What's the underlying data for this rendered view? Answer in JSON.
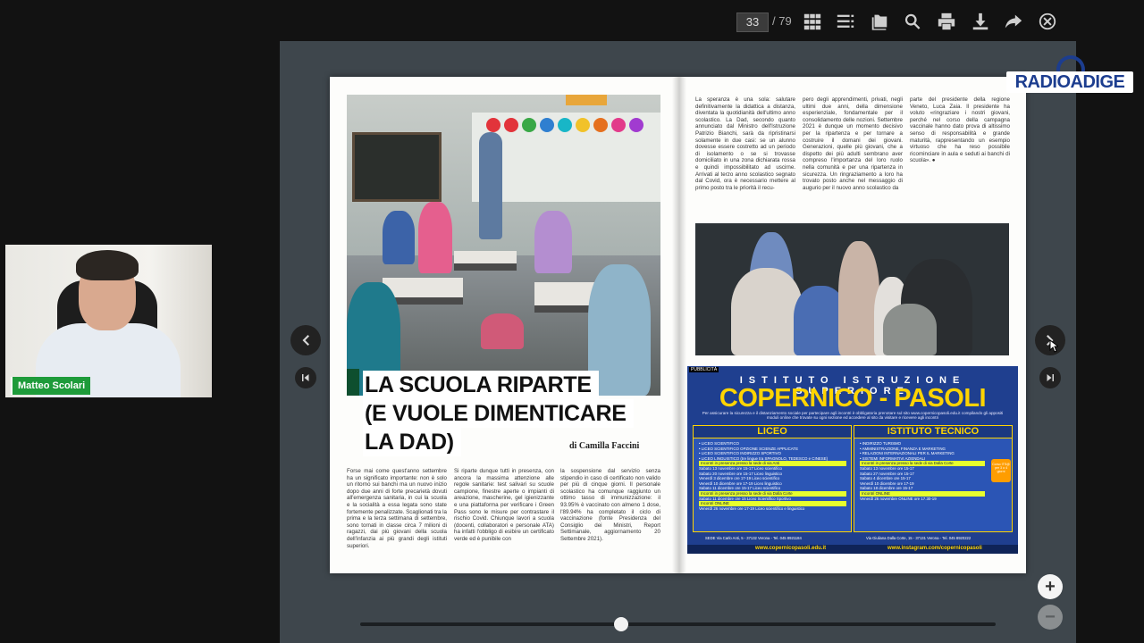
{
  "toolbar": {
    "current_page": "33",
    "total_pages": "/ 79",
    "icons": [
      "grid-icon",
      "list-icon",
      "folder-icon",
      "search-icon",
      "print-icon",
      "download-icon",
      "share-icon",
      "close-icon"
    ]
  },
  "article": {
    "headline_line1": "LA SCUOLA RIPARTE",
    "headline_line2": "(E VUOLE DIMENTICARE",
    "headline_line3": "LA DAD)",
    "byline": "di Camilla Faccini",
    "col1": "Forse mai come quest'anno settembre ha un significato importante: non è solo un ritorno sui banchi ma un nuovo inizio dopo due anni di forte precarietà dovuti all'emergenza sanitaria, in cui la scuola e la socialità a essa legata sono state fortemente penalizzate. Scaglionati tra la prima e la terza settimana di settembre, sono tornati in classe circa 7 milioni di ragazzi, dai più giovani della scuola dell'infanzia ai più grandi degli istituti superiori.",
    "col2": "Si riparte dunque tutti in presenza, con ancora la massima attenzione alle regole sanitarie: test salivari su scuole campione, finestre aperte o impianti di areazione, mascherine, gel igienizzante e una piattaforma per verificare i Green Pass sono le misure per contrastare il rischio Covid. Chiunque lavori a scuola (docenti, collaboratori e personale ATA) ha infatti l'obbligo di esibire un certificato verde ed è punibile con",
    "col3": "la sospensione dal servizio senza stipendio in caso di certificato non valido per più di cinque giorni. Il personale scolastico ha comunque raggiunto un ottimo tasso di immunizzazione: il 93.95% è vaccinato con almeno 1 dose, l'89.94% ha completato il ciclo di vaccinazione (fonte Presidenza del Consiglio dei Ministri, Report Settimanale, aggiornamento 20 Settembre 2021).",
    "col4": "La speranza è una sola: salutare definitivamente la didattica a distanza, diventata la quotidianità dell'ultimo anno scolastico. La Dad, secondo quanto annunciato dal Ministro dell'Istruzione Patrizio Bianchi, sarà da ripristinarsi solamente in due casi: se un alunno dovesse essere costretto ad un periodo di isolamento o se si trovasse domiciliato in una zona dichiarata rossa e quindi impossibilitato ad uscirne. Arrivati al terzo anno scolastico segnato dal Covid, ora è necessario mettere al primo posto tra le priorità il recu-",
    "col5": "pero degli apprendimenti, privati, negli ultimi due anni, della dimensione esperienziale, fondamentale per il consolidamento delle nozioni. Settembre 2021 è dunque un momento decisivo per la ripartenza e per tornare a costruire il domani dei giovani. Generazioni, quelle più giovani, che a dispetto dei più adulti sembrano aver compreso l'importanza del loro ruolo nella comunità e per una ripartenza in sicurezza. Un ringraziamento a loro ha trovato posto anche nel messaggio di augurio per il nuovo anno scolastico da",
    "col6": "parte del presidente della regione Veneto, Luca Zaia. Il presidente ha voluto «ringraziare i nostri giovani, perché nel corso della campagna vaccinale hanno dato prova di altissimo senso di responsabilità e grande maturità, rappresentando un esempio virtuoso che ha reso possibile ricominciare in aula e seduti ai banchi di scuola». ●"
  },
  "ad": {
    "tag": "PUBBLICITÀ",
    "top": "ISTITUTO ISTRUZIONE SUPERIORE",
    "title": "COPERNICO - PASOLI",
    "subtitle": "Per assicurare la sicurezza e il distanziamento sociale per partecipare agli incontri è obbligatoria prenotare sul sito www.copernicopasoli.edu.it compilando gli appositi moduli online che trovate su ogni sezione ed accedere al sito da visitare e ricevere agli incontri",
    "liceo_title": "LICEO",
    "liceo_lines": [
      "• LICEO SCIENTIFICO",
      "• LICEO SCIENTIFICO OPZIONE SCIENZE APPLICATE",
      "• LICEO SCIENTIFICO INDIRIZZO SPORTIVO",
      "• LICEO LINGUISTICO (tre lingue tra SPAGNOLO, TEDESCO e CINESE)",
      "Incontri in presenza presso la sede di via Anti",
      "Sabato 13 novembre ore 15-17 Liceo scientifico",
      "Sabato 20 novembre ore 15-17 Liceo linguistico",
      "Venerdì 3 dicembre ore 17-19 Liceo scientifico",
      "Venerdì 10 dicembre ore 17-19 Liceo linguistico",
      "Sabato 11 dicembre ore 15-17 Liceo scientifico",
      "Incontri in presenza presso la sede di via Dalla Corte",
      "Sabato 11 dicembre ore 15 Liceo Scientifico Sportivo",
      "Incontri ONLINE",
      "Venerdì 26 novembre ore 17-19 Liceo scientifico e linguistico"
    ],
    "tecnico_title": "ISTITUTO TECNICO",
    "tecnico_lines": [
      "• INDIRIZZO TURISMO",
      "• AMMINISTRAZIONE, FINANZA E MARKETING",
      "• RELAZIONI INTERNAZIONALI PER IL MARKETING",
      "• SISTEMI INFORMATIVI AZIENDALI",
      "Incontri in presenza presso la sede di via Dalla Corte",
      "Sabato 13 novembre ore 15-17",
      "Sabato 27 novembre ore 15-17",
      "Sabato 4 dicembre ore 15-17",
      "Venerdì 10 dicembre ore 17-19",
      "Sabato 18 dicembre ore 15-17",
      "Incontri ONLINE",
      "Venerdì 26 novembre ONLINE ore 17.30-19"
    ],
    "orange_badge": "Corso ITS@ per 3 o 4 giorni",
    "addr_left": "SEDE Via Carlo Anti, 5 - 37132 Verona - Tel. 045 8921184",
    "addr_right": "Via Giuliana Dalla Corte, 15 - 37131 Verona - Tel. 045 8920222",
    "footer_left": "www.copernicopasoli.edu.it",
    "footer_right": "www.instagram.com/copernicopasoli"
  },
  "webcam": {
    "name": "Matteo Scolari"
  },
  "logo": {
    "text": "RADIOADIGE"
  },
  "zoom": {
    "plus": "+",
    "minus": "−"
  },
  "slider": {
    "position_fraction": 0.41
  }
}
